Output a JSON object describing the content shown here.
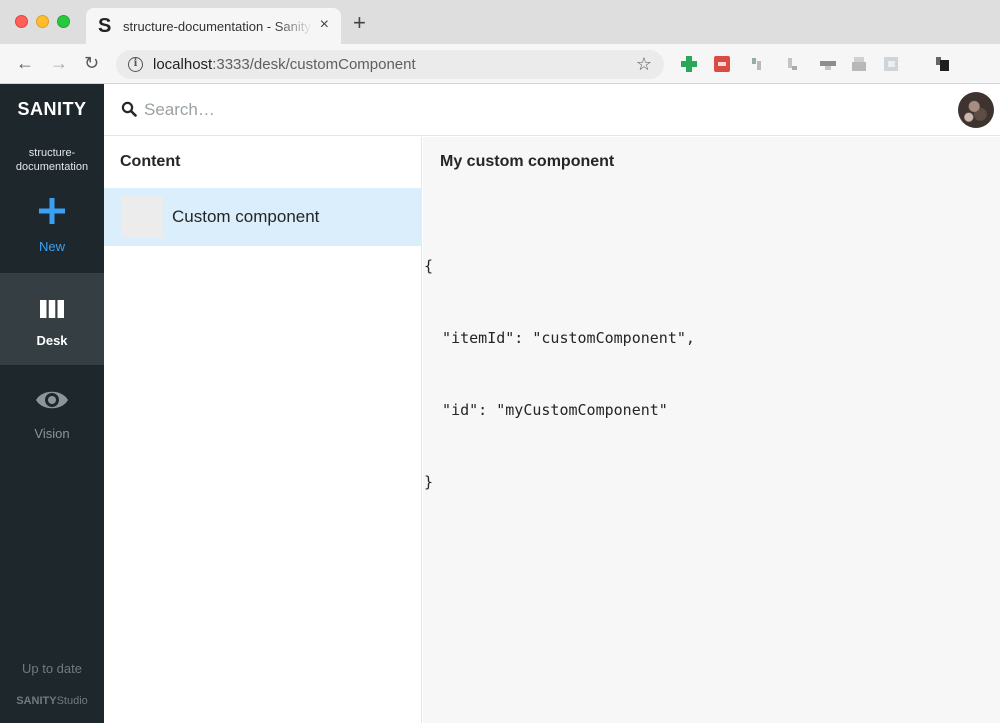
{
  "browser": {
    "tab_favicon": "S",
    "tab_title": "structure-documentation - Sanity",
    "tab_close": "×",
    "new_tab": "+",
    "nav": {
      "back": "←",
      "forward": "→",
      "reload": "↻"
    },
    "info_icon": "i",
    "url_host": "localhost",
    "url_rest": ":3333/desk/customComponent",
    "bookmark_star": "☆",
    "extensions": [
      "extension-1",
      "extension-2",
      "extension-3",
      "extension-4",
      "extension-5",
      "extension-6",
      "extension-7",
      "extension-8"
    ]
  },
  "sidebar": {
    "logo": "SANITY",
    "project_line1": "structure-",
    "project_line2": "documentation",
    "items": [
      {
        "label": "New",
        "icon": "plus-icon"
      },
      {
        "label": "Desk",
        "icon": "columns-icon",
        "active": true
      },
      {
        "label": "Vision",
        "icon": "eye-icon"
      }
    ],
    "status": "Up to date",
    "studio_brand": "SANITY",
    "studio_suffix": "Studio"
  },
  "search": {
    "placeholder": "Search…",
    "icon": "search-icon"
  },
  "content_pane": {
    "title": "Content",
    "items": [
      {
        "label": "Custom component",
        "selected": true
      }
    ]
  },
  "custom_pane": {
    "title": "My custom component",
    "json_lines": [
      "{",
      "  \"itemId\": \"customComponent\",",
      "  \"id\": \"myCustomComponent\"",
      "}"
    ]
  },
  "colors": {
    "sidebar_bg": "#1e272b",
    "sidebar_active": "#353e43",
    "accent": "#3aa0f5",
    "selected_row": "#dbeefb"
  }
}
